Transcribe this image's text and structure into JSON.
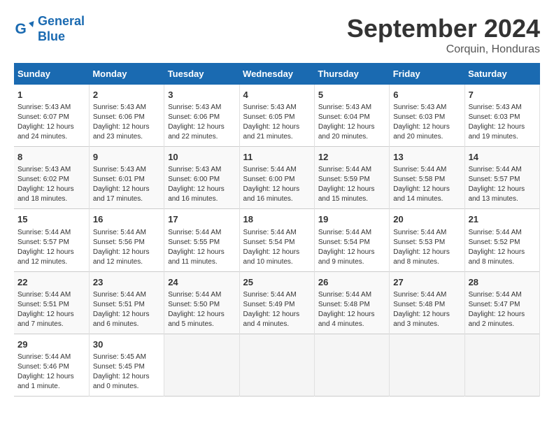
{
  "logo": {
    "line1": "General",
    "line2": "Blue"
  },
  "title": "September 2024",
  "subtitle": "Corquin, Honduras",
  "days_of_week": [
    "Sunday",
    "Monday",
    "Tuesday",
    "Wednesday",
    "Thursday",
    "Friday",
    "Saturday"
  ],
  "weeks": [
    [
      {
        "day": "1",
        "info": "Sunrise: 5:43 AM\nSunset: 6:07 PM\nDaylight: 12 hours\nand 24 minutes."
      },
      {
        "day": "2",
        "info": "Sunrise: 5:43 AM\nSunset: 6:06 PM\nDaylight: 12 hours\nand 23 minutes."
      },
      {
        "day": "3",
        "info": "Sunrise: 5:43 AM\nSunset: 6:06 PM\nDaylight: 12 hours\nand 22 minutes."
      },
      {
        "day": "4",
        "info": "Sunrise: 5:43 AM\nSunset: 6:05 PM\nDaylight: 12 hours\nand 21 minutes."
      },
      {
        "day": "5",
        "info": "Sunrise: 5:43 AM\nSunset: 6:04 PM\nDaylight: 12 hours\nand 20 minutes."
      },
      {
        "day": "6",
        "info": "Sunrise: 5:43 AM\nSunset: 6:03 PM\nDaylight: 12 hours\nand 20 minutes."
      },
      {
        "day": "7",
        "info": "Sunrise: 5:43 AM\nSunset: 6:03 PM\nDaylight: 12 hours\nand 19 minutes."
      }
    ],
    [
      {
        "day": "8",
        "info": "Sunrise: 5:43 AM\nSunset: 6:02 PM\nDaylight: 12 hours\nand 18 minutes."
      },
      {
        "day": "9",
        "info": "Sunrise: 5:43 AM\nSunset: 6:01 PM\nDaylight: 12 hours\nand 17 minutes."
      },
      {
        "day": "10",
        "info": "Sunrise: 5:43 AM\nSunset: 6:00 PM\nDaylight: 12 hours\nand 16 minutes."
      },
      {
        "day": "11",
        "info": "Sunrise: 5:44 AM\nSunset: 6:00 PM\nDaylight: 12 hours\nand 16 minutes."
      },
      {
        "day": "12",
        "info": "Sunrise: 5:44 AM\nSunset: 5:59 PM\nDaylight: 12 hours\nand 15 minutes."
      },
      {
        "day": "13",
        "info": "Sunrise: 5:44 AM\nSunset: 5:58 PM\nDaylight: 12 hours\nand 14 minutes."
      },
      {
        "day": "14",
        "info": "Sunrise: 5:44 AM\nSunset: 5:57 PM\nDaylight: 12 hours\nand 13 minutes."
      }
    ],
    [
      {
        "day": "15",
        "info": "Sunrise: 5:44 AM\nSunset: 5:57 PM\nDaylight: 12 hours\nand 12 minutes."
      },
      {
        "day": "16",
        "info": "Sunrise: 5:44 AM\nSunset: 5:56 PM\nDaylight: 12 hours\nand 12 minutes."
      },
      {
        "day": "17",
        "info": "Sunrise: 5:44 AM\nSunset: 5:55 PM\nDaylight: 12 hours\nand 11 minutes."
      },
      {
        "day": "18",
        "info": "Sunrise: 5:44 AM\nSunset: 5:54 PM\nDaylight: 12 hours\nand 10 minutes."
      },
      {
        "day": "19",
        "info": "Sunrise: 5:44 AM\nSunset: 5:54 PM\nDaylight: 12 hours\nand 9 minutes."
      },
      {
        "day": "20",
        "info": "Sunrise: 5:44 AM\nSunset: 5:53 PM\nDaylight: 12 hours\nand 8 minutes."
      },
      {
        "day": "21",
        "info": "Sunrise: 5:44 AM\nSunset: 5:52 PM\nDaylight: 12 hours\nand 8 minutes."
      }
    ],
    [
      {
        "day": "22",
        "info": "Sunrise: 5:44 AM\nSunset: 5:51 PM\nDaylight: 12 hours\nand 7 minutes."
      },
      {
        "day": "23",
        "info": "Sunrise: 5:44 AM\nSunset: 5:51 PM\nDaylight: 12 hours\nand 6 minutes."
      },
      {
        "day": "24",
        "info": "Sunrise: 5:44 AM\nSunset: 5:50 PM\nDaylight: 12 hours\nand 5 minutes."
      },
      {
        "day": "25",
        "info": "Sunrise: 5:44 AM\nSunset: 5:49 PM\nDaylight: 12 hours\nand 4 minutes."
      },
      {
        "day": "26",
        "info": "Sunrise: 5:44 AM\nSunset: 5:48 PM\nDaylight: 12 hours\nand 4 minutes."
      },
      {
        "day": "27",
        "info": "Sunrise: 5:44 AM\nSunset: 5:48 PM\nDaylight: 12 hours\nand 3 minutes."
      },
      {
        "day": "28",
        "info": "Sunrise: 5:44 AM\nSunset: 5:47 PM\nDaylight: 12 hours\nand 2 minutes."
      }
    ],
    [
      {
        "day": "29",
        "info": "Sunrise: 5:44 AM\nSunset: 5:46 PM\nDaylight: 12 hours\nand 1 minute."
      },
      {
        "day": "30",
        "info": "Sunrise: 5:45 AM\nSunset: 5:45 PM\nDaylight: 12 hours\nand 0 minutes."
      },
      {
        "day": "",
        "info": ""
      },
      {
        "day": "",
        "info": ""
      },
      {
        "day": "",
        "info": ""
      },
      {
        "day": "",
        "info": ""
      },
      {
        "day": "",
        "info": ""
      }
    ]
  ]
}
